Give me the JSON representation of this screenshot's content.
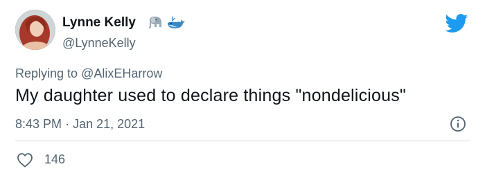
{
  "tweet": {
    "author_name": "Lynne Kelly",
    "author_handle": "@LynneKelly",
    "name_emojis": [
      "elephant-icon",
      "whale-icon"
    ],
    "replying_prefix": "Replying to",
    "replying_to": "@AlixEHarrow",
    "text": "My daughter used to declare things \"nondelicious\"",
    "time": "8:43 PM",
    "separator": "·",
    "date": "Jan 21, 2021",
    "like_count": "146"
  },
  "colors": {
    "twitter_blue": "#1d9bf0",
    "secondary_text": "#536471",
    "primary_text": "#0f1419",
    "divider": "#cfd9de"
  },
  "icons": {
    "brand": "twitter-bird-icon",
    "info": "info-icon",
    "like": "heart-icon"
  }
}
